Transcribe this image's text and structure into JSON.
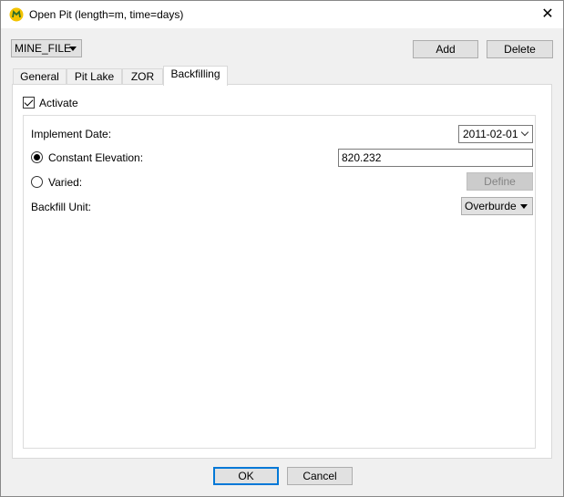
{
  "window": {
    "title": "Open Pit (length=m, time=days)",
    "close_glyph": "✕"
  },
  "toolbar": {
    "file_select_value": "MINE_FILE",
    "add_label": "Add",
    "delete_label": "Delete"
  },
  "tabs": [
    {
      "label": "General"
    },
    {
      "label": "Pit Lake"
    },
    {
      "label": "ZOR"
    },
    {
      "label": "Backfilling"
    }
  ],
  "backfilling": {
    "activate_label": "Activate",
    "activate_checked": true,
    "implement_date_label": "Implement Date:",
    "implement_date_value": "2011-02-01",
    "constant_elevation_label": "Constant Elevation:",
    "constant_elevation_value": "820.232",
    "varied_label": "Varied:",
    "define_label": "Define",
    "backfill_unit_label": "Backfill Unit:",
    "backfill_unit_value": "Overburde"
  },
  "footer": {
    "ok_label": "OK",
    "cancel_label": "Cancel"
  },
  "icons": {
    "app": "mine-app-icon",
    "close": "close-icon"
  }
}
